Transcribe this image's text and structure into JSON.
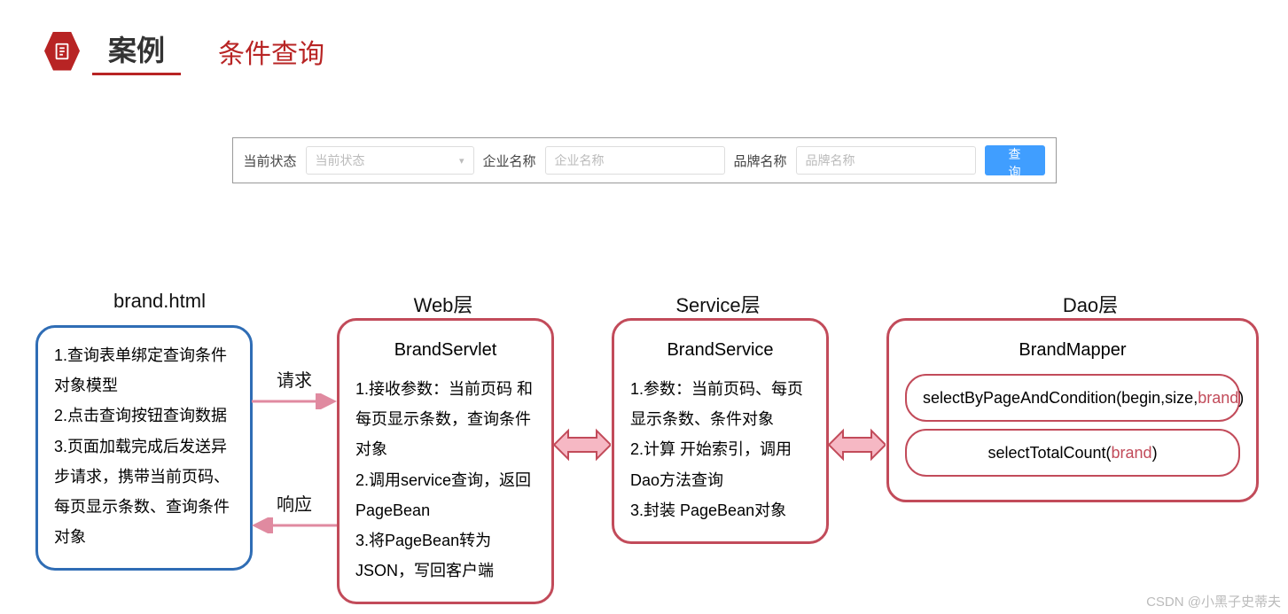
{
  "header": {
    "badge_label": "案例",
    "subtitle": "条件查询"
  },
  "search": {
    "status_label": "当前状态",
    "status_placeholder": "当前状态",
    "company_label": "企业名称",
    "company_placeholder": "企业名称",
    "brand_label": "品牌名称",
    "brand_placeholder": "品牌名称",
    "query_btn": "查询"
  },
  "columns": {
    "ui": {
      "title": "brand.html"
    },
    "web": {
      "title": "Web层",
      "box_title": "BrandServlet"
    },
    "service": {
      "title": "Service层",
      "box_title": "BrandService"
    },
    "dao": {
      "title": "Dao层",
      "box_title": "BrandMapper"
    }
  },
  "ui_items": {
    "i1": "1.查询表单绑定查询条件对象模型",
    "i2": "2.点击查询按钮查询数据",
    "i3": "3.页面加载完成后发送异步请求，携带当前页码、每页显示条数、查询条件对象"
  },
  "web_items": {
    "i1": "1.接收参数：当前页码 和每页显示条数，查询条件对象",
    "i2": "2.调用service查询，返回PageBean",
    "i3": "3.将PageBean转为JSON，写回客户端"
  },
  "service_items": {
    "i1": "1.参数：当前页码、每页显示条数、条件对象",
    "i2": "2.计算 开始索引，调用Dao方法查询",
    "i3": "3.封装 PageBean对象"
  },
  "dao_items": {
    "m1a": "selectByPageAndCondition(begin,size,",
    "m1b": "brand",
    "m1c": ")",
    "m2a": "selectTotalCount(",
    "m2b": "brand",
    "m2c": ")"
  },
  "arrows": {
    "request": "请求",
    "response": "响应"
  },
  "watermark": "CSDN @小黑子史蒂夫"
}
